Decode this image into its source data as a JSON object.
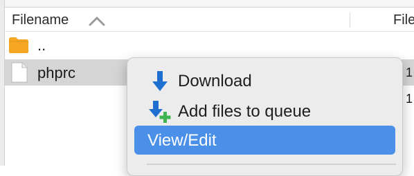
{
  "file_list": {
    "columns": {
      "filename": "Filename",
      "filesize": "File"
    },
    "sort": {
      "column": "filename",
      "direction": "ascending",
      "icon": "chevron-up-icon"
    },
    "rows": [
      {
        "name": "..",
        "icon": "folder-icon",
        "selected": false,
        "size": ""
      },
      {
        "name": "phprc",
        "icon": "file-icon",
        "selected": true,
        "size": "1"
      }
    ],
    "extra_size": "1"
  },
  "context_menu": {
    "items": [
      {
        "label": "Download",
        "icon": "download-arrow-icon",
        "highlighted": false
      },
      {
        "label": "Add files to queue",
        "icon": "add-to-queue-icon",
        "highlighted": false
      },
      {
        "label": "View/Edit",
        "icon": "",
        "highlighted": true
      }
    ]
  },
  "colors": {
    "selection_row": "#d5d5d5",
    "menu_highlight": "#4a90e8",
    "folder": "#f5a623",
    "download_arrow": "#1f6fd1",
    "plus_green": "#3fb34f"
  }
}
